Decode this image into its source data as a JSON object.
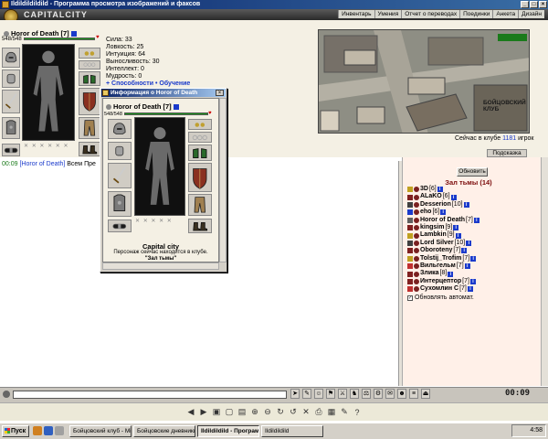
{
  "window": {
    "title": "Ildildildildild - Программа просмотра изображений и факсов"
  },
  "header": {
    "logo_text": "CAPITALCITY",
    "nav": [
      "Инвентарь",
      "Умения",
      "Отчет о переводах",
      "Поединки",
      "Анкета",
      "Дизайн"
    ]
  },
  "character": {
    "name": "Horor of Death",
    "level": "[7]",
    "hp": "548/548",
    "hp_fraction": 1.0,
    "stats": [
      {
        "label": "Сила:",
        "value": "33"
      },
      {
        "label": "Ловкость:",
        "value": "25"
      },
      {
        "label": "Интуиция:",
        "value": "64"
      },
      {
        "label": "Выносливость:",
        "value": "30"
      },
      {
        "label": "Интеллект:",
        "value": "0"
      },
      {
        "label": "Мудрость:",
        "value": "0"
      }
    ],
    "links": "+ Способности • Обучение"
  },
  "map": {
    "label": "БОЙЦОВСКИЙ КЛУБ"
  },
  "online": {
    "prefix": "Сейчас в клубе",
    "count": "1181",
    "suffix": "игрок"
  },
  "hint_button": "Подсказка",
  "chat": {
    "line": {
      "time": "00:09",
      "nick": "[Horor of Death]",
      "text": "Всем Пре"
    }
  },
  "room": {
    "update_button": "Обновить",
    "title": "Зал тьмы (14)",
    "players": [
      {
        "name": "3D",
        "level": "[6]",
        "color": "#c0a020"
      },
      {
        "name": "ALaKO",
        "level": "[6]",
        "color": "#802020"
      },
      {
        "name": "Desserion",
        "level": "[10]",
        "color": "#404040"
      },
      {
        "name": "eho",
        "level": "[6]",
        "color": "#1a3acb"
      },
      {
        "name": "Horor of Death",
        "level": "[7]",
        "color": "#606060"
      },
      {
        "name": "kingsim",
        "level": "[9]",
        "color": "#802020"
      },
      {
        "name": "Lambkin",
        "level": "[9]",
        "color": "#c0a020"
      },
      {
        "name": "Lord Silver",
        "level": "[10]",
        "color": "#404040"
      },
      {
        "name": "Oboroteny",
        "level": "[7]",
        "color": "#802020"
      },
      {
        "name": "Tolstij_Trofim",
        "level": "[7]",
        "color": "#c0a020"
      },
      {
        "name": "Вильгельм",
        "level": "[7]",
        "color": "#c03030"
      },
      {
        "name": "Злика",
        "level": "[8]",
        "color": "#802020"
      },
      {
        "name": "Интерцептор",
        "level": "[7]",
        "color": "#802020"
      },
      {
        "name": "Сухомлин С",
        "level": "[7]",
        "color": "#c03030"
      }
    ],
    "auto_update": "Обновлять автомат."
  },
  "clock": "00:09",
  "popup": {
    "title": "Информация о Horor of Death",
    "name": "Horor of Death",
    "level": "[7]",
    "hp": "548/548",
    "city": "Capital city",
    "note1": "Персонаж сейчас находится в клубе.",
    "note2": "\"Зал тьмы\""
  },
  "taskbar": {
    "start": "Пуск",
    "tasks": [
      {
        "label": "Бойцовский клуб - Mic...",
        "active": false
      },
      {
        "label": "Бойцовские дневники -...",
        "active": false
      },
      {
        "label": "Ildildildild - Програм...",
        "active": true
      },
      {
        "label": "Ildildildild",
        "active": false
      }
    ],
    "time": "4:58"
  },
  "colors": {
    "accent": "#1a3acb",
    "room_title": "#7a0a0a",
    "hp": "#1a9a1a",
    "chat_time": "#1a7a1a"
  }
}
